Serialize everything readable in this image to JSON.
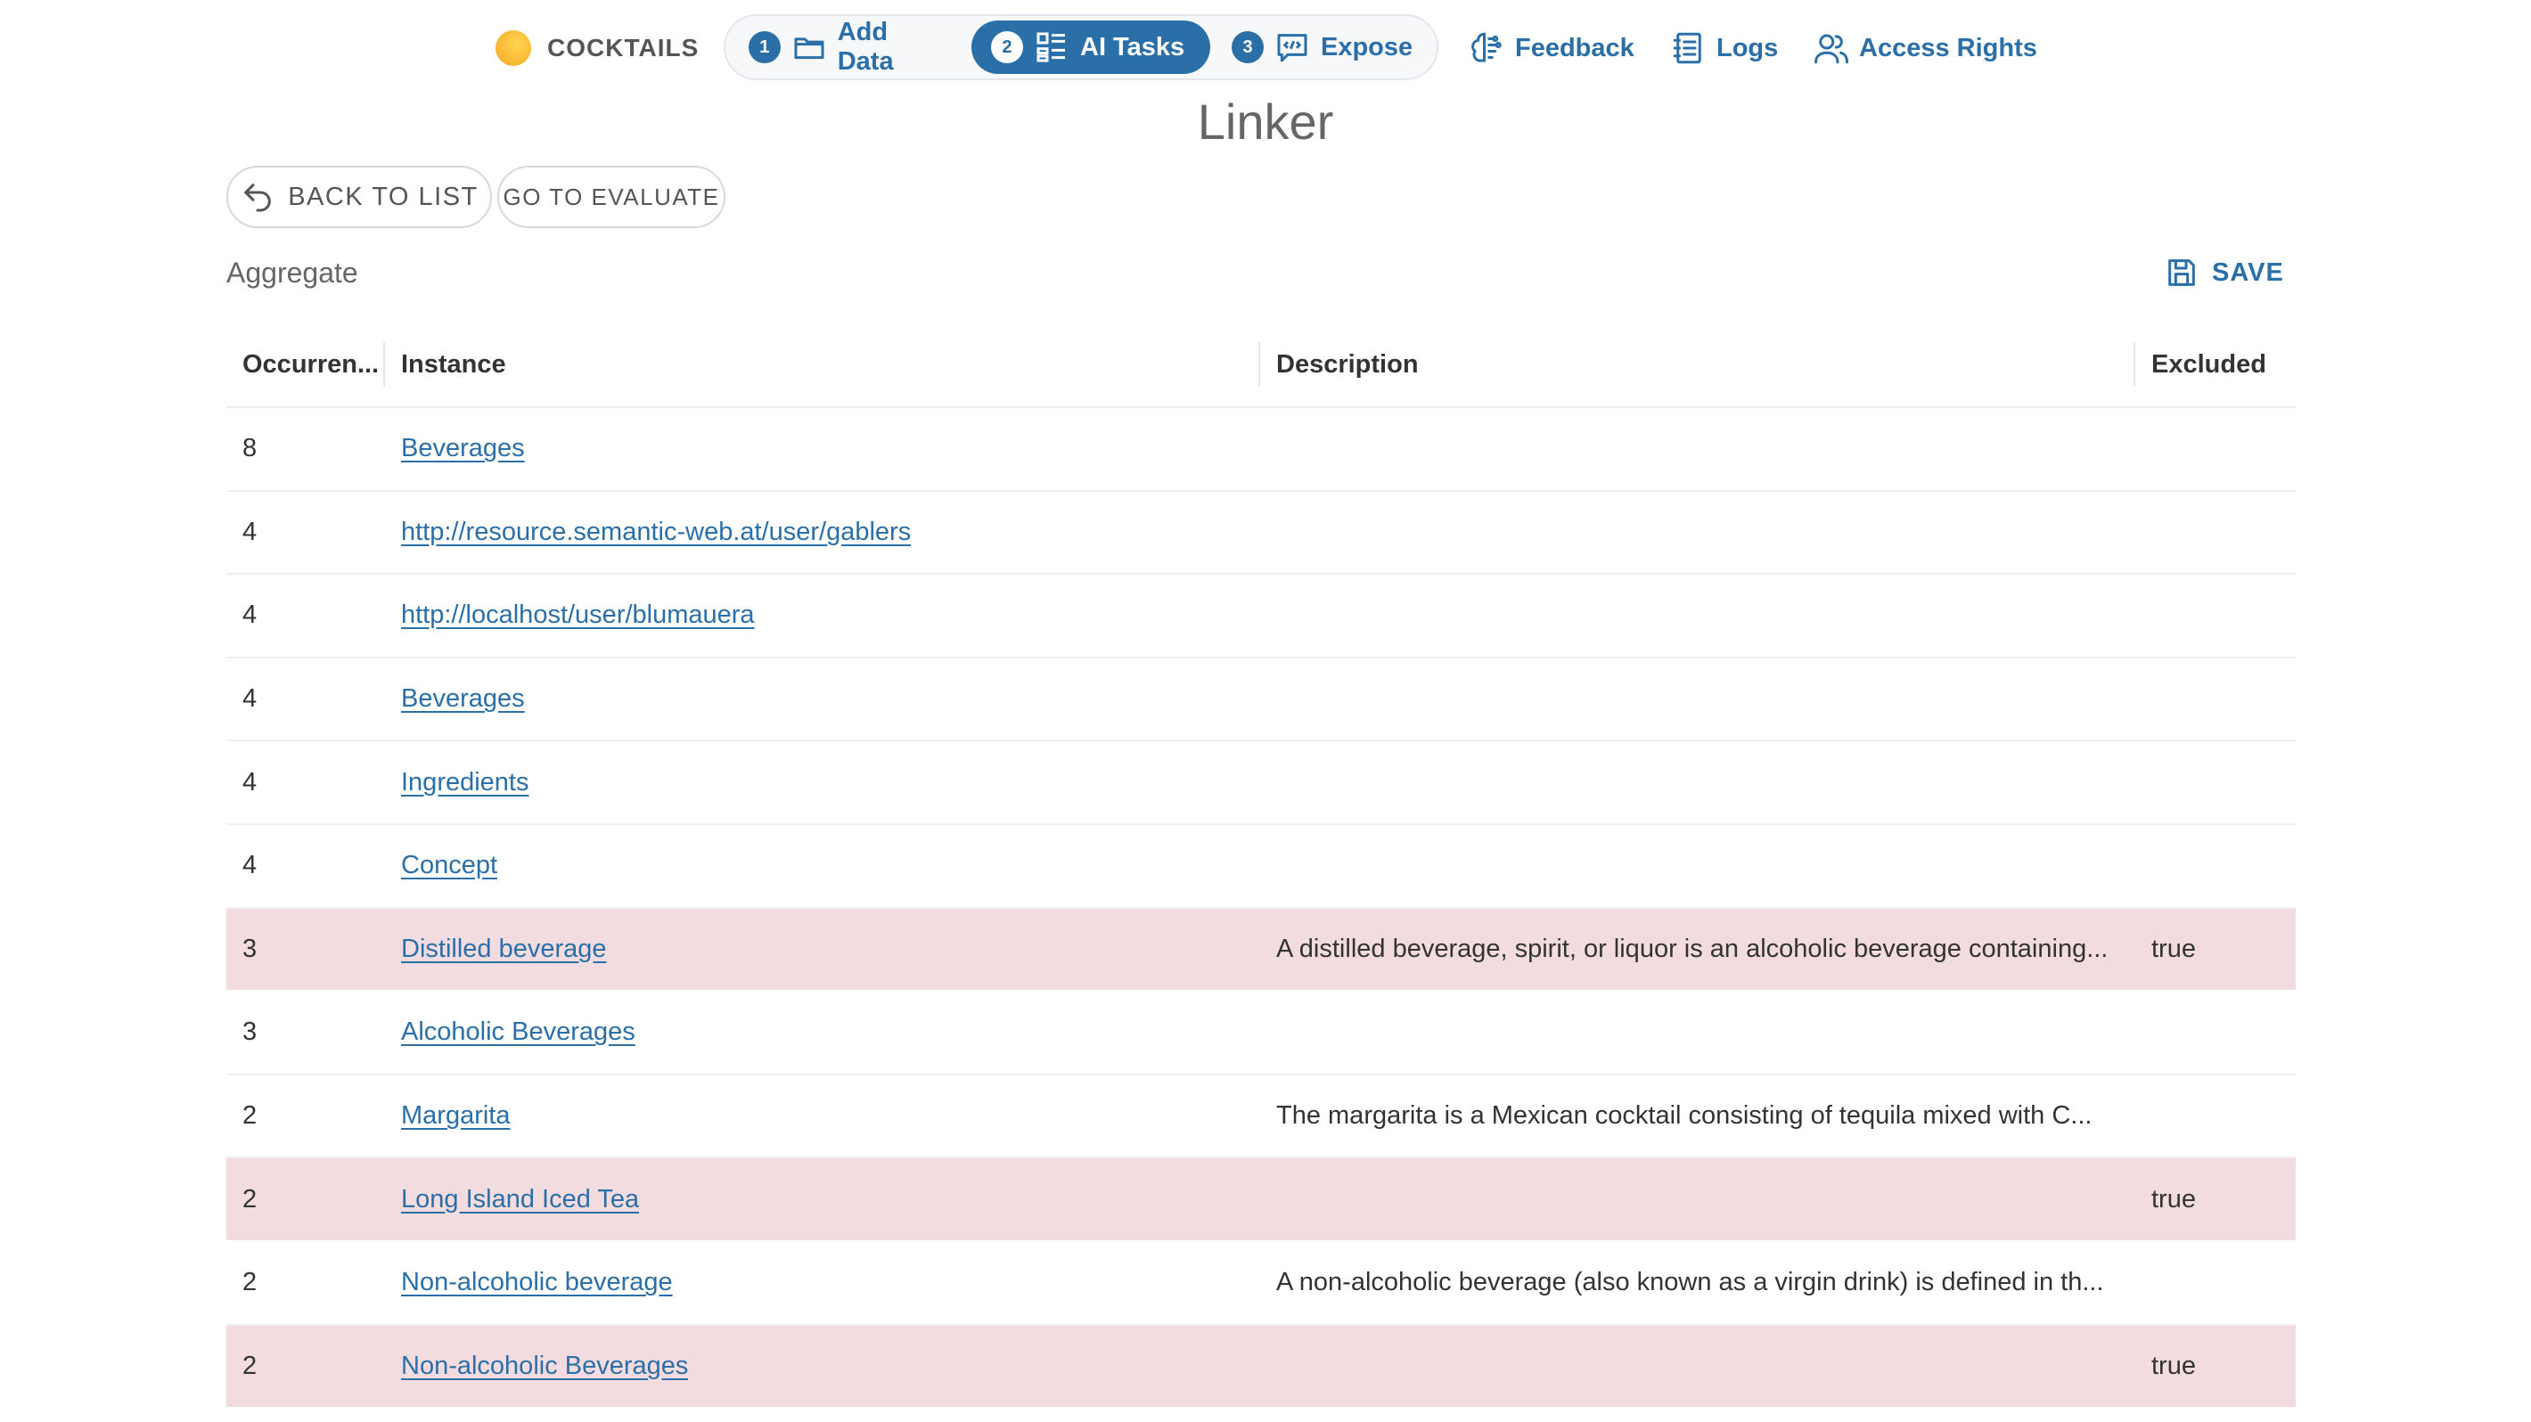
{
  "project": {
    "name": "COCKTAILS"
  },
  "stepper": [
    {
      "num": "1",
      "label": "Add Data",
      "icon": "folder-icon"
    },
    {
      "num": "2",
      "label": "AI Tasks",
      "icon": "grid-list-icon"
    },
    {
      "num": "3",
      "label": "Expose",
      "icon": "code-chat-icon"
    }
  ],
  "nav": {
    "feedback": "Feedback",
    "logs": "Logs",
    "access_rights": "Access Rights"
  },
  "page": {
    "title": "Linker"
  },
  "actions": {
    "back_to_list": "BACK TO LIST",
    "go_to_evaluate": "GO TO EVALUATE",
    "save": "SAVE"
  },
  "section": {
    "label": "Aggregate"
  },
  "table": {
    "headers": {
      "occurrences": "Occurren...",
      "instance": "Instance",
      "description": "Description",
      "excluded": "Excluded"
    },
    "rows": [
      {
        "occurrences": "8",
        "instance": "Beverages",
        "description": "",
        "excluded": ""
      },
      {
        "occurrences": "4",
        "instance": "http://resource.semantic-web.at/user/gablers",
        "description": "",
        "excluded": ""
      },
      {
        "occurrences": "4",
        "instance": "http://localhost/user/blumauera",
        "description": "",
        "excluded": ""
      },
      {
        "occurrences": "4",
        "instance": "Beverages",
        "description": "",
        "excluded": ""
      },
      {
        "occurrences": "4",
        "instance": "Ingredients",
        "description": "",
        "excluded": ""
      },
      {
        "occurrences": "4",
        "instance": "Concept",
        "description": "",
        "excluded": ""
      },
      {
        "occurrences": "3",
        "instance": "Distilled beverage",
        "description": "A distilled beverage, spirit, or liquor is an alcoholic beverage containing...",
        "excluded": "true"
      },
      {
        "occurrences": "3",
        "instance": "Alcoholic Beverages",
        "description": "",
        "excluded": ""
      },
      {
        "occurrences": "2",
        "instance": "Margarita",
        "description": "The margarita is a Mexican cocktail consisting of tequila mixed with C...",
        "excluded": ""
      },
      {
        "occurrences": "2",
        "instance": "Long Island Iced Tea",
        "description": "",
        "excluded": "true"
      },
      {
        "occurrences": "2",
        "instance": "Non-alcoholic beverage",
        "description": "A non-alcoholic beverage (also known as a virgin drink) is defined in th...",
        "excluded": ""
      },
      {
        "occurrences": "2",
        "instance": "Non-alcoholic Beverages",
        "description": "",
        "excluded": "true"
      }
    ]
  },
  "colors": {
    "accent": "#2a6fa8",
    "excluded_row": "#f2dcdf",
    "project_dot": "#f6a623"
  }
}
